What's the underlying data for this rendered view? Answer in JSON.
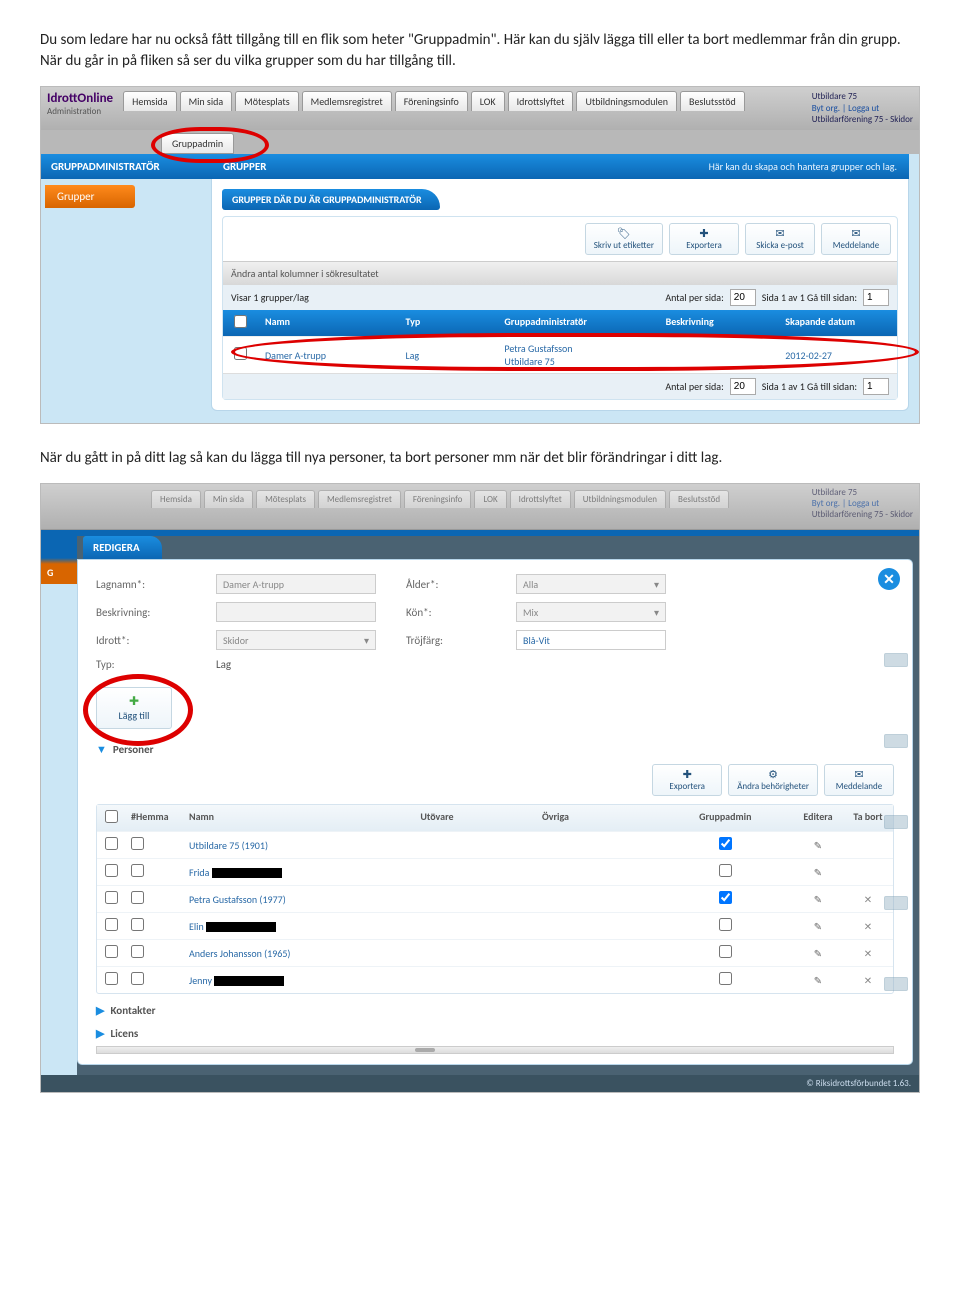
{
  "p1": "Du som ledare har nu också fått tillgång till en flik som heter \"Gruppadmin\". Här kan du själv lägga till eller ta bort medlemmar från din grupp. När du går in på fliken så ser du vilka grupper som du har tillgång till.",
  "p2": "När du gått in på ditt lag så kan du lägga till nya personer, ta bort personer mm när det blir förändringar i ditt lag.",
  "s1": {
    "logo1": "IdrottOnline",
    "logo2": "Administration",
    "tabs": [
      "Hemsida",
      "Min sida",
      "Mötesplats",
      "Medlemsregistret",
      "Föreningsinfo",
      "LOK",
      "Idrottslyftet",
      "Utbildningsmodulen",
      "Beslutsstöd"
    ],
    "tabExtra": "Gruppadmin",
    "user": {
      "name": "Utbildare 75",
      "links": "Byt org. | Logga ut",
      "org": "Utbildarförening 75 - Skidor"
    },
    "sideHdr": "GRUPPADMINISTRATÖR",
    "sideTab": "Grupper",
    "mainHdr": "GRUPPER",
    "mainDesc": "Här kan du skapa och hantera grupper och lag.",
    "subHdr": "GRUPPER DÄR DU ÄR GRUPPADMINISTRATÖR",
    "actions": [
      "Skriv ut etiketter",
      "Exportera",
      "Skicka e-post",
      "Meddelande"
    ],
    "colLabel": "Ändra antal kolumner i sökresultatet",
    "showing": "Visar 1 grupper/lag",
    "perPage": "Antal per sida:",
    "perPageVal": "20",
    "pageInfo": "Sida 1 av 1 Gå till sidan:",
    "pageVal": "1",
    "th": [
      "Namn",
      "Typ",
      "Gruppadministratör",
      "Beskrivning",
      "Skapande datum"
    ],
    "row": {
      "namn": "Damer A-trupp",
      "typ": "Lag",
      "ga": "Petra Gustafsson\nUtbildare 75",
      "besk": "",
      "datum": "2012-02-27"
    }
  },
  "s2": {
    "tabsFaint": [
      "Hemsida",
      "Min sida",
      "Mötesplats",
      "Medlemsregistret",
      "Föreningsinfo",
      "LOK",
      "Idrottslyftet",
      "Utbildningsmodulen",
      "Beslutsstöd"
    ],
    "user": {
      "name": "Utbildare 75",
      "links": "Byt org. | Logga ut",
      "org": "Utbildarförening 75 - Skidor"
    },
    "sideLetter": "G",
    "modalTab": "REDIGERA",
    "fields": {
      "lagnamn_l": "Lagnamn*:",
      "lagnamn_v": "Damer A-trupp",
      "alder_l": "Ålder*:",
      "alder_v": "Alla",
      "beskr_l": "Beskrivning:",
      "beskr_v": "",
      "kon_l": "Kön*:",
      "kon_v": "Mix",
      "idrott_l": "Idrott*:",
      "idrott_v": "Skidor",
      "troj_l": "Tröjfärg:",
      "troj_v": "Blå-Vit",
      "typ_l": "Typ:",
      "typ_v": "Lag"
    },
    "addBtn": "Lägg till",
    "sectPersoner": "Personer",
    "actions": [
      "Exportera",
      "Ändra behörigheter",
      "Meddelande"
    ],
    "th": [
      "#Hemma",
      "Namn",
      "Utövare",
      "Övriga",
      "Gruppadmin",
      "Editera",
      "Ta bort"
    ],
    "rows": [
      {
        "namn": "Utbildare 75 (1901)",
        "ga": true
      },
      {
        "namn": "Frida ",
        "mask": true
      },
      {
        "namn": "Petra Gustafsson (1977)",
        "ga": true,
        "tb": true
      },
      {
        "namn": "Elin ",
        "mask": true,
        "tb": true
      },
      {
        "namn": "Anders Johansson (1965)",
        "tb": true
      },
      {
        "namn": "Jenny ",
        "mask": true,
        "tb": true
      }
    ],
    "sectKontakter": "Kontakter",
    "sectLicens": "Licens",
    "footer": "© Riksidrottsförbundet 1.63."
  }
}
